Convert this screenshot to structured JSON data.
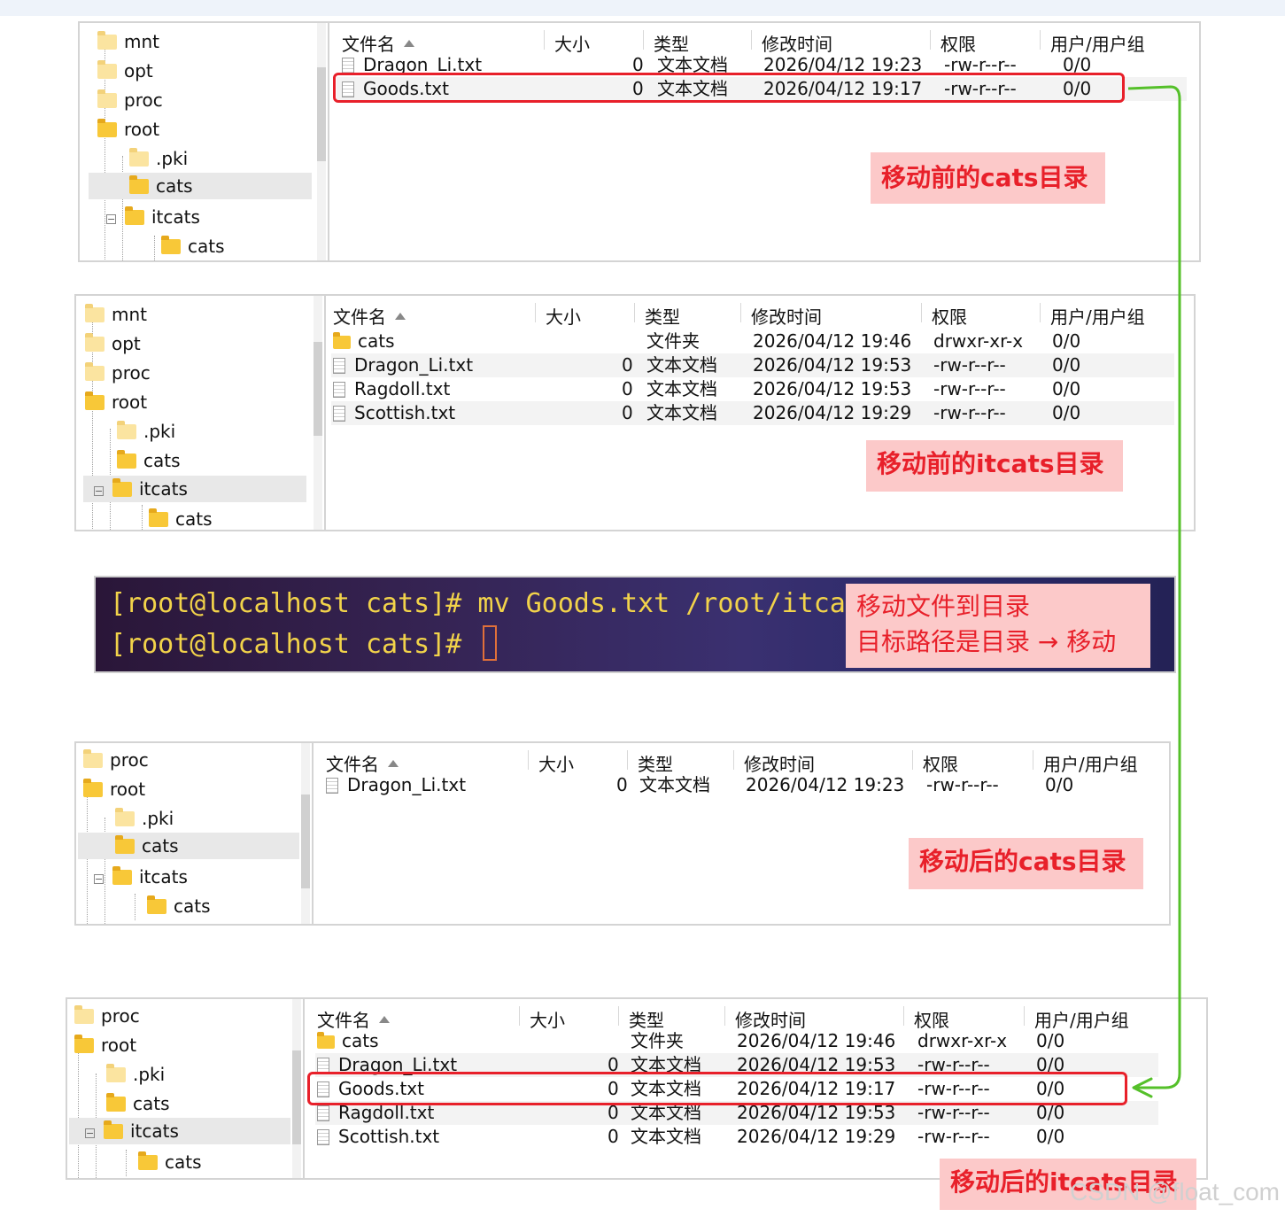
{
  "columns": [
    "文件名",
    "大小",
    "类型",
    "修改时间",
    "权限",
    "用户/用户组"
  ],
  "panel1": {
    "tree": [
      {
        "label": "mnt"
      },
      {
        "label": "opt"
      },
      {
        "label": "proc"
      },
      {
        "label": "root"
      },
      {
        "label": ".pki"
      },
      {
        "label": "cats"
      },
      {
        "label": "itcats"
      },
      {
        "label": "cats"
      }
    ],
    "files": [
      {
        "name": "Dragon_Li.txt",
        "size": "0",
        "type": "文本文档",
        "mtime": "2026/04/12 19:23",
        "perm": "-rw-r--r--",
        "owner": "0/0"
      },
      {
        "name": "Goods.txt",
        "size": "0",
        "type": "文本文档",
        "mtime": "2026/04/12 19:17",
        "perm": "-rw-r--r--",
        "owner": "0/0"
      }
    ],
    "note": "移动前的cats目录"
  },
  "panel2": {
    "tree": [
      {
        "label": "mnt"
      },
      {
        "label": "opt"
      },
      {
        "label": "proc"
      },
      {
        "label": "root"
      },
      {
        "label": ".pki"
      },
      {
        "label": "cats"
      },
      {
        "label": "itcats"
      },
      {
        "label": "cats"
      }
    ],
    "files": [
      {
        "name": "cats",
        "size": "",
        "type": "文件夹",
        "mtime": "2026/04/12 19:46",
        "perm": "drwxr-xr-x",
        "owner": "0/0"
      },
      {
        "name": "Dragon_Li.txt",
        "size": "0",
        "type": "文本文档",
        "mtime": "2026/04/12 19:53",
        "perm": "-rw-r--r--",
        "owner": "0/0"
      },
      {
        "name": "Ragdoll.txt",
        "size": "0",
        "type": "文本文档",
        "mtime": "2026/04/12 19:53",
        "perm": "-rw-r--r--",
        "owner": "0/0"
      },
      {
        "name": "Scottish.txt",
        "size": "0",
        "type": "文本文档",
        "mtime": "2026/04/12 19:29",
        "perm": "-rw-r--r--",
        "owner": "0/0"
      }
    ],
    "note": "移动前的itcats目录"
  },
  "terminal": {
    "line1": "[root@localhost cats]# mv Goods.txt /root/itcats/",
    "line2": "[root@localhost cats]# ",
    "note_line1": "移动文件到目录",
    "note_line2": "目标路径是目录 → 移动"
  },
  "panel3": {
    "tree": [
      {
        "label": "proc"
      },
      {
        "label": "root"
      },
      {
        "label": ".pki"
      },
      {
        "label": "cats"
      },
      {
        "label": "itcats"
      },
      {
        "label": "cats"
      }
    ],
    "files": [
      {
        "name": "Dragon_Li.txt",
        "size": "0",
        "type": "文本文档",
        "mtime": "2026/04/12 19:23",
        "perm": "-rw-r--r--",
        "owner": "0/0"
      }
    ],
    "note": "移动后的cats目录"
  },
  "panel4": {
    "tree": [
      {
        "label": "proc"
      },
      {
        "label": "root"
      },
      {
        "label": ".pki"
      },
      {
        "label": "cats"
      },
      {
        "label": "itcats"
      },
      {
        "label": "cats"
      }
    ],
    "files": [
      {
        "name": "cats",
        "size": "",
        "type": "文件夹",
        "mtime": "2026/04/12 19:46",
        "perm": "drwxr-xr-x",
        "owner": "0/0"
      },
      {
        "name": "Dragon_Li.txt",
        "size": "0",
        "type": "文本文档",
        "mtime": "2026/04/12 19:53",
        "perm": "-rw-r--r--",
        "owner": "0/0"
      },
      {
        "name": "Goods.txt",
        "size": "0",
        "type": "文本文档",
        "mtime": "2026/04/12 19:17",
        "perm": "-rw-r--r--",
        "owner": "0/0"
      },
      {
        "name": "Ragdoll.txt",
        "size": "0",
        "type": "文本文档",
        "mtime": "2026/04/12 19:53",
        "perm": "-rw-r--r--",
        "owner": "0/0"
      },
      {
        "name": "Scottish.txt",
        "size": "0",
        "type": "文本文档",
        "mtime": "2026/04/12 19:29",
        "perm": "-rw-r--r--",
        "owner": "0/0"
      }
    ],
    "note": "移动后的itcats目录"
  },
  "watermark": "CSDN @float_com",
  "colors": {
    "highlight": "#e8202a",
    "note_bg": "#fcc9c9",
    "arrow": "#55c02a",
    "terminal_text": "#f2d34a"
  }
}
